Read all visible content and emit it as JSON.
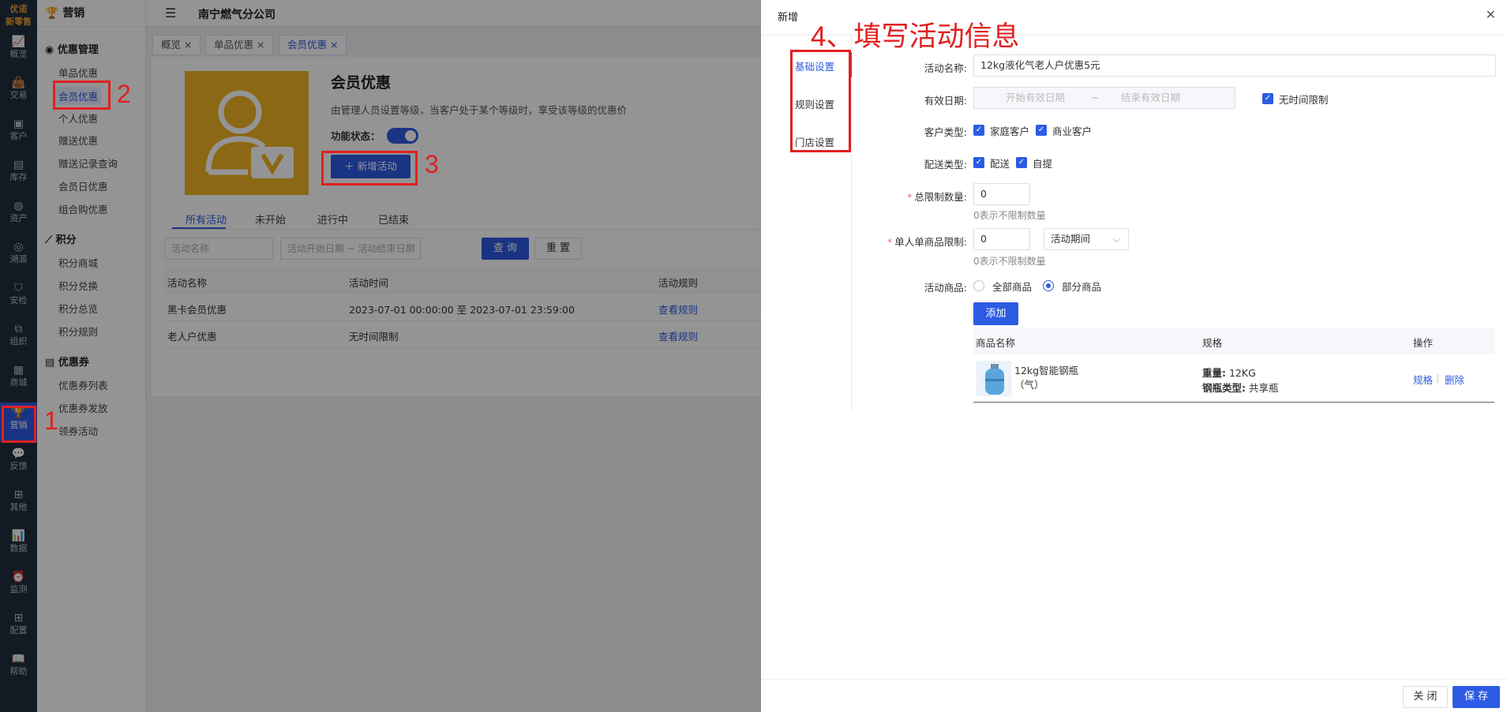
{
  "logo": {
    "line1": "优诺",
    "line2": "新零售"
  },
  "rail": [
    {
      "label": "概览",
      "icon": "chart-icon"
    },
    {
      "label": "交易",
      "icon": "bag-icon"
    },
    {
      "label": "客户",
      "icon": "user-card-icon"
    },
    {
      "label": "库存",
      "icon": "inventory-icon"
    },
    {
      "label": "资产",
      "icon": "bulb-icon"
    },
    {
      "label": "溯源",
      "icon": "compass-icon"
    },
    {
      "label": "安检",
      "icon": "shield-icon"
    },
    {
      "label": "组织",
      "icon": "org-icon"
    },
    {
      "label": "商城",
      "icon": "store-icon"
    },
    {
      "label": "营销",
      "icon": "trophy-icon"
    },
    {
      "label": "反馈",
      "icon": "chat-icon"
    },
    {
      "label": "其他",
      "icon": "grid-icon"
    },
    {
      "label": "数据",
      "icon": "data-chart-icon"
    },
    {
      "label": "监测",
      "icon": "alarm-icon"
    },
    {
      "label": "配置",
      "icon": "config-icon"
    },
    {
      "label": "帮助",
      "icon": "book-icon"
    }
  ],
  "subnav": {
    "title": "营销",
    "groups": [
      {
        "label": "优惠管理",
        "items": [
          "单品优惠",
          "会员优惠",
          "个人优惠",
          "赠送优惠",
          "赠送记录查询",
          "会员日优惠",
          "组合购优惠"
        ]
      },
      {
        "label": "积分",
        "items": [
          "积分商城",
          "积分兑换",
          "积分总览",
          "积分规则"
        ]
      },
      {
        "label": "优惠券",
        "items": [
          "优惠券列表",
          "优惠券发放",
          "领券活动"
        ]
      }
    ]
  },
  "header": {
    "company": "南宁燃气分公司"
  },
  "tabs": [
    "概览",
    "单品优惠",
    "会员优惠"
  ],
  "banner": {
    "title": "会员优惠",
    "desc": "由管理人员设置等级，当客户处于某个等级时，享受该等级的优惠价",
    "status_label": "功能状态：",
    "new_button": "新增活动"
  },
  "content_tabs": [
    "所有活动",
    "未开始",
    "进行中",
    "已结束"
  ],
  "filter": {
    "name_placeholder": "活动名称",
    "date_placeholder": "活动开始日期 ~ 活动结束日期",
    "query": "查 询",
    "reset": "重 置"
  },
  "table": {
    "headers": [
      "活动名称",
      "活动时间",
      "活动规则"
    ],
    "rows": [
      {
        "name": "黑卡会员优惠",
        "time": "2023-07-01 00:00:00 至 2023-07-01 23:59:00",
        "rule": "查看规则"
      },
      {
        "name": "老人户优惠",
        "time": "无时间限制",
        "rule": "查看规则"
      }
    ]
  },
  "drawer": {
    "title": "新增",
    "side_tabs": [
      "基础设置",
      "规则设置",
      "门店设置"
    ],
    "form": {
      "name_label": "活动名称:",
      "name_value": "12kg液化气老人户优惠5元",
      "date_label": "有效日期:",
      "date_start": "开始有效日期",
      "date_sep": "~",
      "date_end": "结束有效日期",
      "no_limit": "无时间限制",
      "customer_label": "客户类型:",
      "customer_opts": [
        "家庭客户",
        "商业客户"
      ],
      "delivery_label": "配送类型:",
      "delivery_opts": [
        "配送",
        "自提"
      ],
      "total_label": "总限制数量:",
      "total_value": "0",
      "total_hint": "0表示不限制数量",
      "single_label": "单人单商品限制:",
      "single_value": "0",
      "single_period": "活动期间",
      "single_hint": "0表示不限制数量",
      "goods_label": "活动商品:",
      "goods_opts": [
        "全部商品",
        "部分商品"
      ],
      "add_btn": "添加"
    },
    "product_table": {
      "headers": [
        "商品名称",
        "规格",
        "操作"
      ],
      "rows": [
        {
          "name_line1": "12kg智能钢瓶",
          "name_line2": "（气）",
          "spec1_label": "重量:",
          "spec1_value": "12KG",
          "spec2_label": "钢瓶类型:",
          "spec2_value": "共享瓶",
          "op1": "规格",
          "sep": "|",
          "op2": "删除"
        }
      ]
    },
    "close": "关 闭",
    "save": "保 存"
  },
  "annotations": {
    "n1": "1",
    "n2": "2",
    "n3": "3",
    "n4": "4、填写活动信息",
    "color": "#e02020"
  },
  "colors": {
    "accent": "#2d5be3",
    "rail": "#1f2d3d",
    "banner": "#f0b323"
  }
}
